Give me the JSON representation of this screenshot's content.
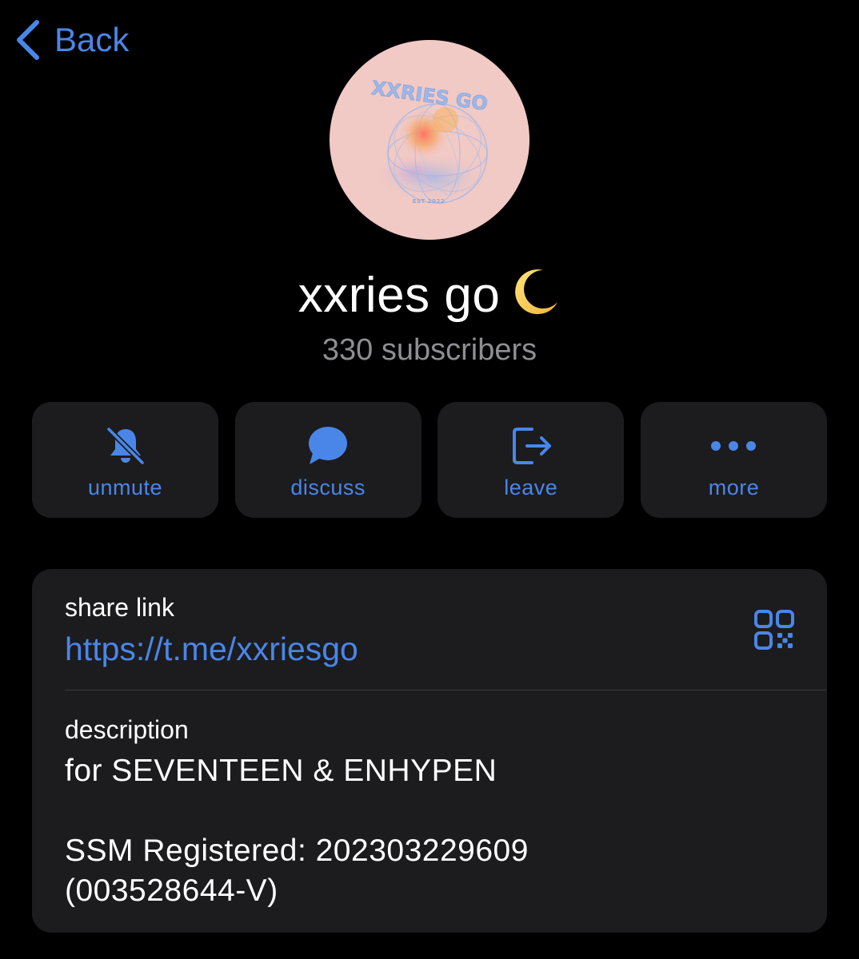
{
  "nav": {
    "back_label": "Back",
    "accent_color": "#4a86e8"
  },
  "avatar": {
    "logo_text": "XXRIES GO",
    "est_text": "EST 2022",
    "background_color": "#f1c9c5"
  },
  "channel": {
    "title": "xxries go",
    "title_emoji": "crescent-moon-icon",
    "subscribers": "330 subscribers"
  },
  "actions": [
    {
      "label": "unmute",
      "icon": "bell-slash-icon"
    },
    {
      "label": "discuss",
      "icon": "chat-bubble-icon"
    },
    {
      "label": "leave",
      "icon": "leave-icon"
    },
    {
      "label": "more",
      "icon": "more-dots-icon"
    }
  ],
  "info": {
    "share_link_label": "share link",
    "share_link_url": "https://t.me/xxriesgo",
    "qr_icon": "qr-code-icon",
    "description_label": "description",
    "description_text": "for SEVENTEEN & ENHYPEN\n\nSSM Registered:  202303229609\n(003528644-V)"
  },
  "colors": {
    "background": "#000000",
    "card": "#1c1c1e",
    "secondary_text": "#8e8e93",
    "divider": "#3a3a3c"
  }
}
